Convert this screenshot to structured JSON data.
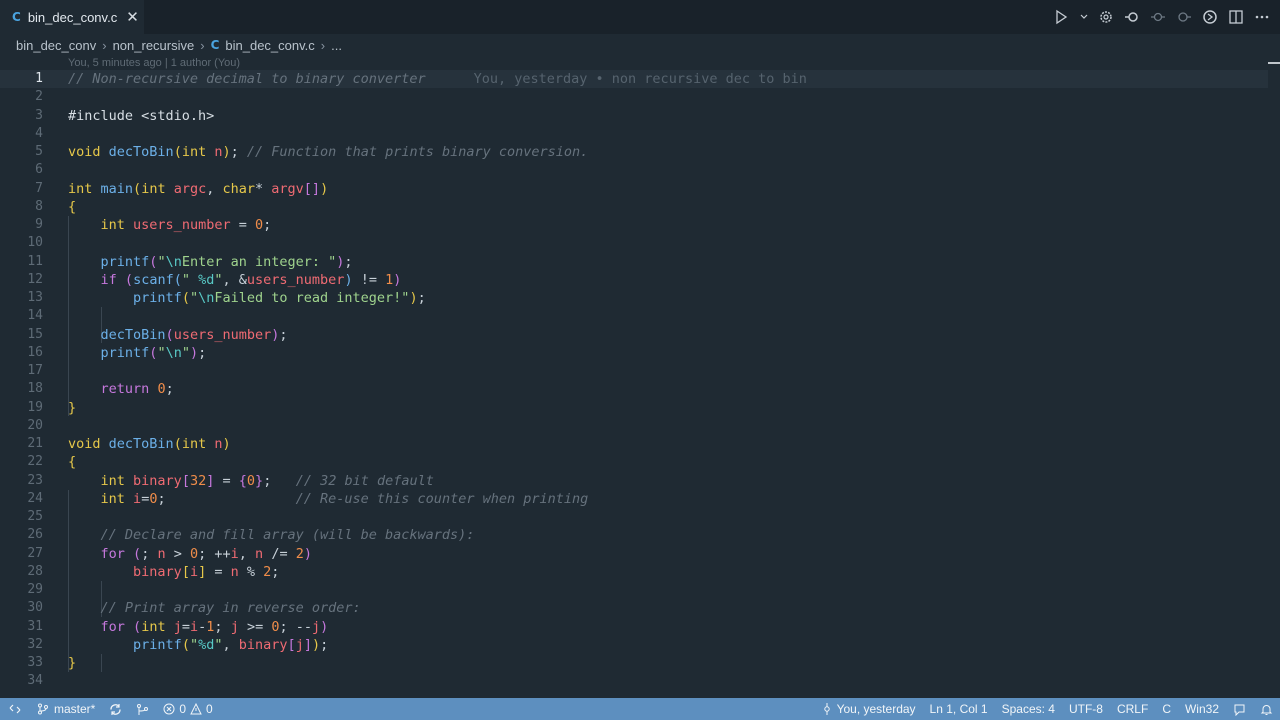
{
  "tab": {
    "icon": "C",
    "label": "bin_dec_conv.c",
    "close": "✕"
  },
  "toolbar": {
    "icons": [
      "run-icon",
      "settings-icon",
      "go-back-icon",
      "go-forward-icon",
      "next-icon",
      "copilot-icon",
      "split-editor-icon",
      "more-icon"
    ]
  },
  "breadcrumb": {
    "items": [
      "bin_dec_conv",
      "non_recursive",
      "bin_dec_conv.c",
      "..."
    ]
  },
  "codelens": "You, 5 minutes ago | 1 author (You)",
  "blame": "You, yesterday • non recursive dec to bin",
  "line_numbers": [
    "1",
    "2",
    "3",
    "4",
    "5",
    "6",
    "7",
    "8",
    "9",
    "10",
    "11",
    "12",
    "13",
    "14",
    "15",
    "16",
    "17",
    "18",
    "19",
    "20",
    "21",
    "22",
    "23",
    "24",
    "25",
    "26",
    "27",
    "28",
    "29",
    "30",
    "31",
    "32",
    "33",
    "34"
  ],
  "status": {
    "branch": "master*",
    "errors": "0",
    "warnings": "0",
    "blame": "You, yesterday",
    "position": "Ln 1, Col 1",
    "spaces": "Spaces: 4",
    "encoding": "UTF-8",
    "eol": "CRLF",
    "language": "C",
    "config": "Win32"
  },
  "colors": {
    "statusbar": "#5d8fbf",
    "editor_bg": "#1f2a33",
    "keyword": "#e6c84a",
    "function": "#6cb0e8",
    "variable": "#ef6b73"
  }
}
